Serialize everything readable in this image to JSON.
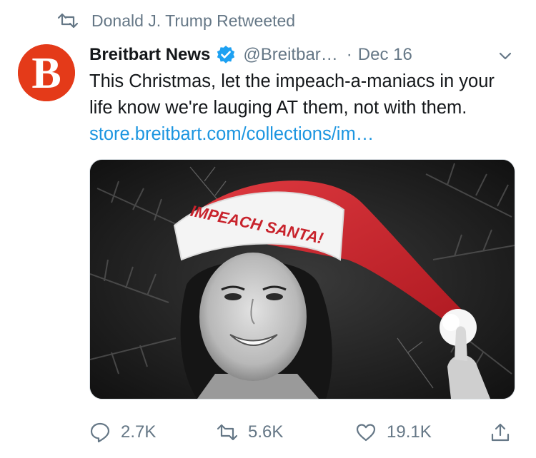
{
  "social_context": {
    "icon": "retweet-icon",
    "text": "Donald J. Trump Retweeted"
  },
  "tweet": {
    "author": {
      "avatar_icon": "breitbart-logo",
      "avatar_color": "#e43a19",
      "display_name": "Breitbart News",
      "verified": true,
      "handle": "@Breitbar…",
      "separator": "·"
    },
    "date": "Dec 16",
    "text_before_link": "This Christmas, let the impeach-a-maniacs in your life know we're lauging AT them, not with them. ",
    "link_text": "store.breitbart.com/collections/im…",
    "media": {
      "hat_text": "IMPEACH SANTA!"
    },
    "actions": {
      "reply_count": "2.7K",
      "retweet_count": "5.6K",
      "like_count": "19.1K"
    }
  },
  "colors": {
    "link": "#1b95e0",
    "muted": "#657786",
    "verified": "#1da1f2",
    "hat": "#c8232c"
  }
}
